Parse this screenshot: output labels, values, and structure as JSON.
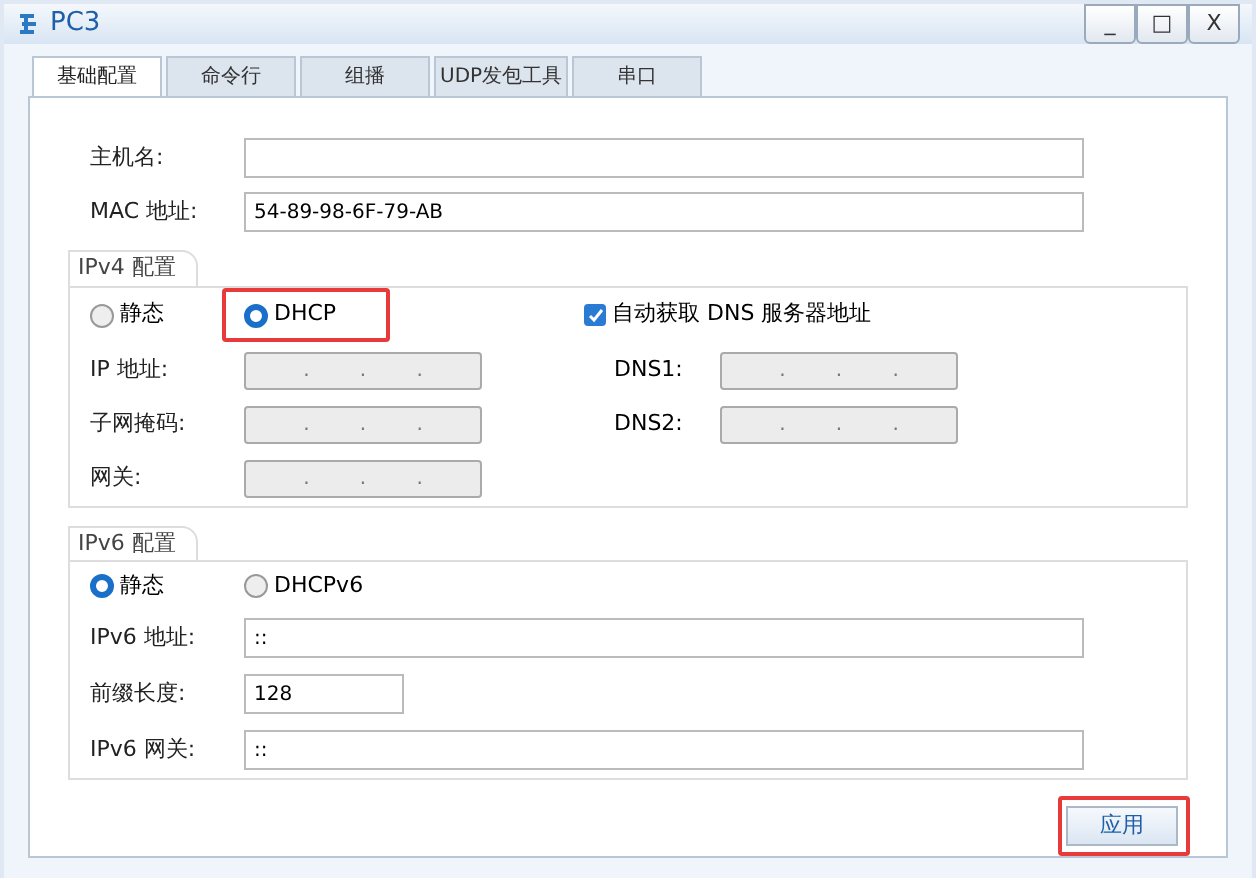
{
  "window": {
    "title": "PC3",
    "controls": [
      "_",
      "□",
      "X"
    ]
  },
  "tabs": [
    {
      "label": "基础配置",
      "selected": true
    },
    {
      "label": "命令行",
      "selected": false
    },
    {
      "label": "组播",
      "selected": false
    },
    {
      "label": "UDP发包工具",
      "selected": false
    },
    {
      "label": "串口",
      "selected": false
    }
  ],
  "host": {
    "label": "主机名:"
  },
  "mac": {
    "label": "MAC 地址:",
    "value": "54-89-98-6F-79-AB"
  },
  "ipv4": {
    "title": "IPv4 配置",
    "modes": [
      {
        "label": "静态",
        "selected": false,
        "highlighted": false
      },
      {
        "label": "DHCP",
        "selected": true,
        "highlighted": true
      }
    ],
    "auto_dns": {
      "label": "自动获取 DNS 服务器地址",
      "checked": true
    },
    "left_fields": [
      {
        "label": "IP 地址:",
        "separators": [
          ".",
          ".",
          "."
        ],
        "disabled": true
      },
      {
        "label": "子网掩码:",
        "separators": [
          ".",
          ".",
          "."
        ],
        "disabled": true
      },
      {
        "label": "网关:",
        "separators": [
          ".",
          ".",
          "."
        ],
        "disabled": true
      }
    ],
    "right_fields": [
      {
        "label": "DNS1:",
        "separators": [
          ".",
          ".",
          "."
        ],
        "disabled": true
      },
      {
        "label": "DNS2:",
        "separators": [
          ".",
          ".",
          "."
        ],
        "disabled": true
      }
    ]
  },
  "ipv6": {
    "title": "IPv6 配置",
    "modes": [
      {
        "label": "静态",
        "selected": true
      },
      {
        "label": "DHCPv6",
        "selected": false
      }
    ],
    "fields": [
      {
        "label": "IPv6 地址:",
        "value": "::",
        "kind": "wide"
      },
      {
        "label": "前缀长度:",
        "value": "128",
        "kind": "short"
      },
      {
        "label": "IPv6 网关:",
        "value": "::",
        "kind": "wide"
      }
    ]
  },
  "apply": {
    "label": "应用",
    "highlighted": true
  }
}
